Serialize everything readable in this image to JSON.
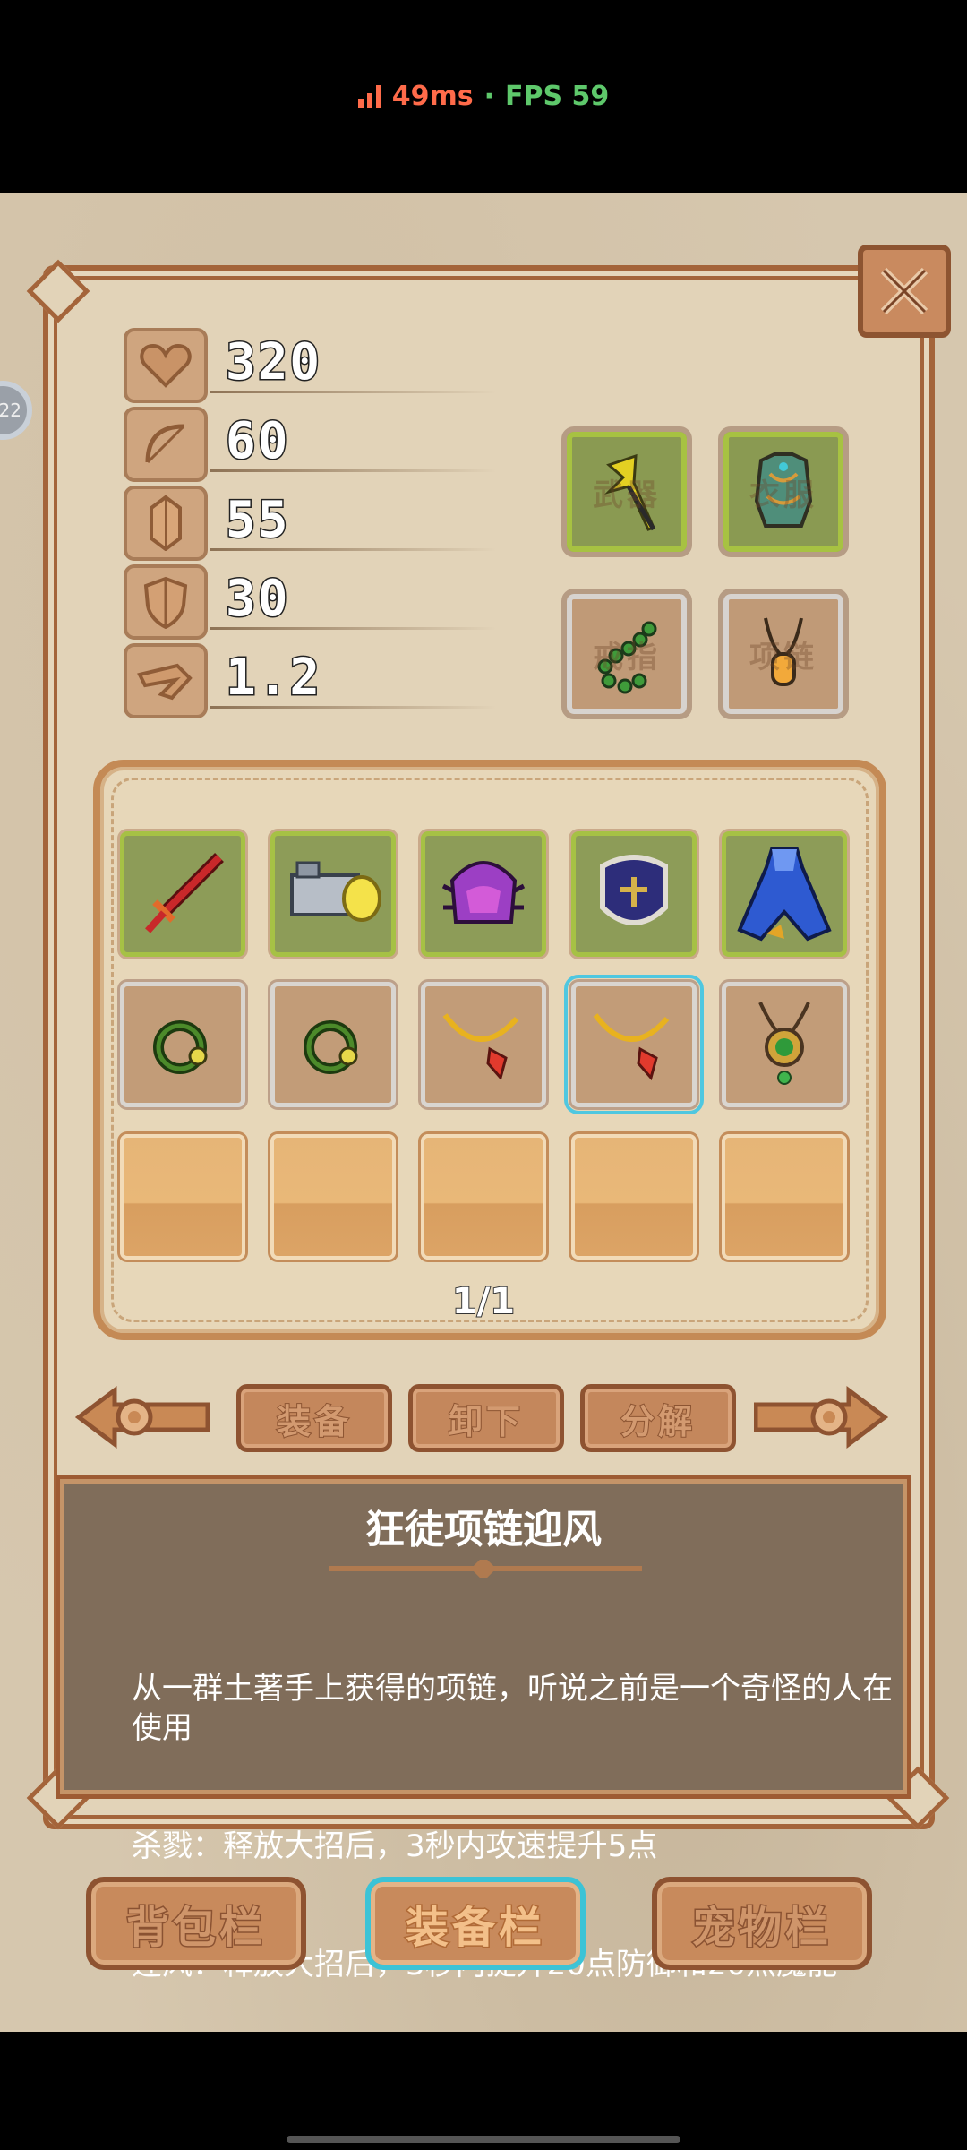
{
  "status_bar": {
    "ping": "49ms",
    "separator": "·",
    "fps": "FPS 59",
    "ping_color": "#ff6b4a",
    "fps_color": "#5ec86b"
  },
  "side_badge": {
    "label": "22"
  },
  "stats": [
    {
      "icon": "heart-icon",
      "value": "320"
    },
    {
      "icon": "bow-icon",
      "value": "60"
    },
    {
      "icon": "crystal-icon",
      "value": "55"
    },
    {
      "icon": "shield-icon",
      "value": "30"
    },
    {
      "icon": "speed-icon",
      "value": "1.2"
    }
  ],
  "equipped": [
    {
      "slot": "武器",
      "item": "golden-spear-icon",
      "state": "filled"
    },
    {
      "slot": "衣服",
      "item": "teal-armor-icon",
      "state": "filled"
    },
    {
      "slot": "戒指",
      "item": "jade-ring-icon",
      "state": "filled"
    },
    {
      "slot": "项链",
      "item": "amber-necklace-icon",
      "state": "filled"
    }
  ],
  "inventory": {
    "page": "1/1",
    "rows": [
      [
        {
          "item": "red-sword-icon",
          "type": "green"
        },
        {
          "item": "cannon-icon",
          "type": "green"
        },
        {
          "item": "purple-helmet-icon",
          "type": "green"
        },
        {
          "item": "blue-shield-icon",
          "type": "green"
        },
        {
          "item": "blue-cloak-icon",
          "type": "green"
        }
      ],
      [
        {
          "item": "green-ring-icon",
          "type": "grey"
        },
        {
          "item": "green-ring-icon",
          "type": "grey"
        },
        {
          "item": "gold-necklace-icon",
          "type": "grey"
        },
        {
          "item": "gold-necklace-icon",
          "type": "grey",
          "selected": true
        },
        {
          "item": "emerald-pendant-icon",
          "type": "grey"
        }
      ],
      [
        {
          "type": "empty"
        },
        {
          "type": "empty"
        },
        {
          "type": "empty"
        },
        {
          "type": "empty"
        },
        {
          "type": "empty"
        }
      ]
    ]
  },
  "actions": {
    "equip": "装备",
    "unequip": "卸下",
    "decompose": "分解"
  },
  "description": {
    "title": "狂徒项链迎风",
    "lines": [
      "从一群土著手上获得的项链，听说之前是一个奇怪的人在使用",
      "杀戮：释放大招后，3秒内攻速提升5点",
      "迎风：释放大招后，3秒内提升20点防御和20点魔能"
    ]
  },
  "tabs": [
    {
      "label": "背包栏",
      "active": false
    },
    {
      "label": "装备栏",
      "active": true
    },
    {
      "label": "宠物栏",
      "active": false
    }
  ]
}
